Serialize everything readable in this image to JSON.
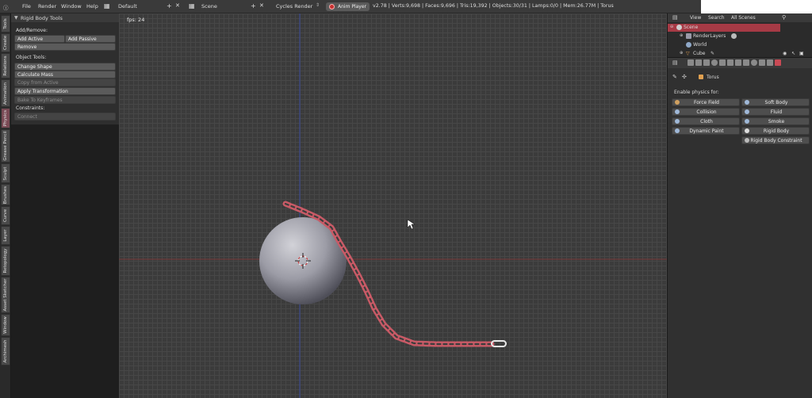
{
  "topbar": {
    "menus": [
      "File",
      "Render",
      "Window",
      "Help"
    ],
    "layout": "Default",
    "scene": "Scene",
    "engine": "Cycles Render",
    "anim_player": "Anim Player",
    "stats": "v2.78 | Verts:9,698 | Faces:9,696 | Tris:19,392 | Objects:30/31 | Lamps:0/0 | Mem:26.77M | Torus"
  },
  "tabs": [
    "Tools",
    "Create",
    "Relations",
    "Animation",
    "Physics",
    "Grease Pencil",
    "Sculpt",
    "Brushes",
    "Curve",
    "Layer",
    "Retopology",
    "Asset Sketcher",
    "Window",
    "Archimesh"
  ],
  "shelf": {
    "title": "Rigid Body Tools",
    "add_remove_label": "Add/Remove:",
    "add_active": "Add Active",
    "add_passive": "Add Passive",
    "remove": "Remove",
    "object_tools_label": "Object Tools:",
    "change_shape": "Change Shape",
    "calculate_mass": "Calculate Mass",
    "copy_from_active": "Copy from Active",
    "apply_transformation": "Apply Transformation",
    "bake_to_keyframes": "Bake To Keyframes",
    "constraints_label": "Constraints:",
    "connect": "Connect"
  },
  "viewport": {
    "fps": "fps: 24"
  },
  "outliner": {
    "view": "View",
    "search": "Search",
    "all_scenes": "All Scenes",
    "rows": [
      "Scene",
      "RenderLayers",
      "World",
      "Cube"
    ]
  },
  "props": {
    "object_name": "Torus",
    "enable_label": "Enable physics for:",
    "left_buttons": [
      "Force Field",
      "Collision",
      "Cloth",
      "Dynamic Paint"
    ],
    "right_buttons": [
      "Soft Body",
      "Fluid",
      "Smoke",
      "Rigid Body",
      "Rigid Body Constraint"
    ]
  },
  "colors": {
    "accent": "#c94a55",
    "chain": "#d6757f"
  }
}
